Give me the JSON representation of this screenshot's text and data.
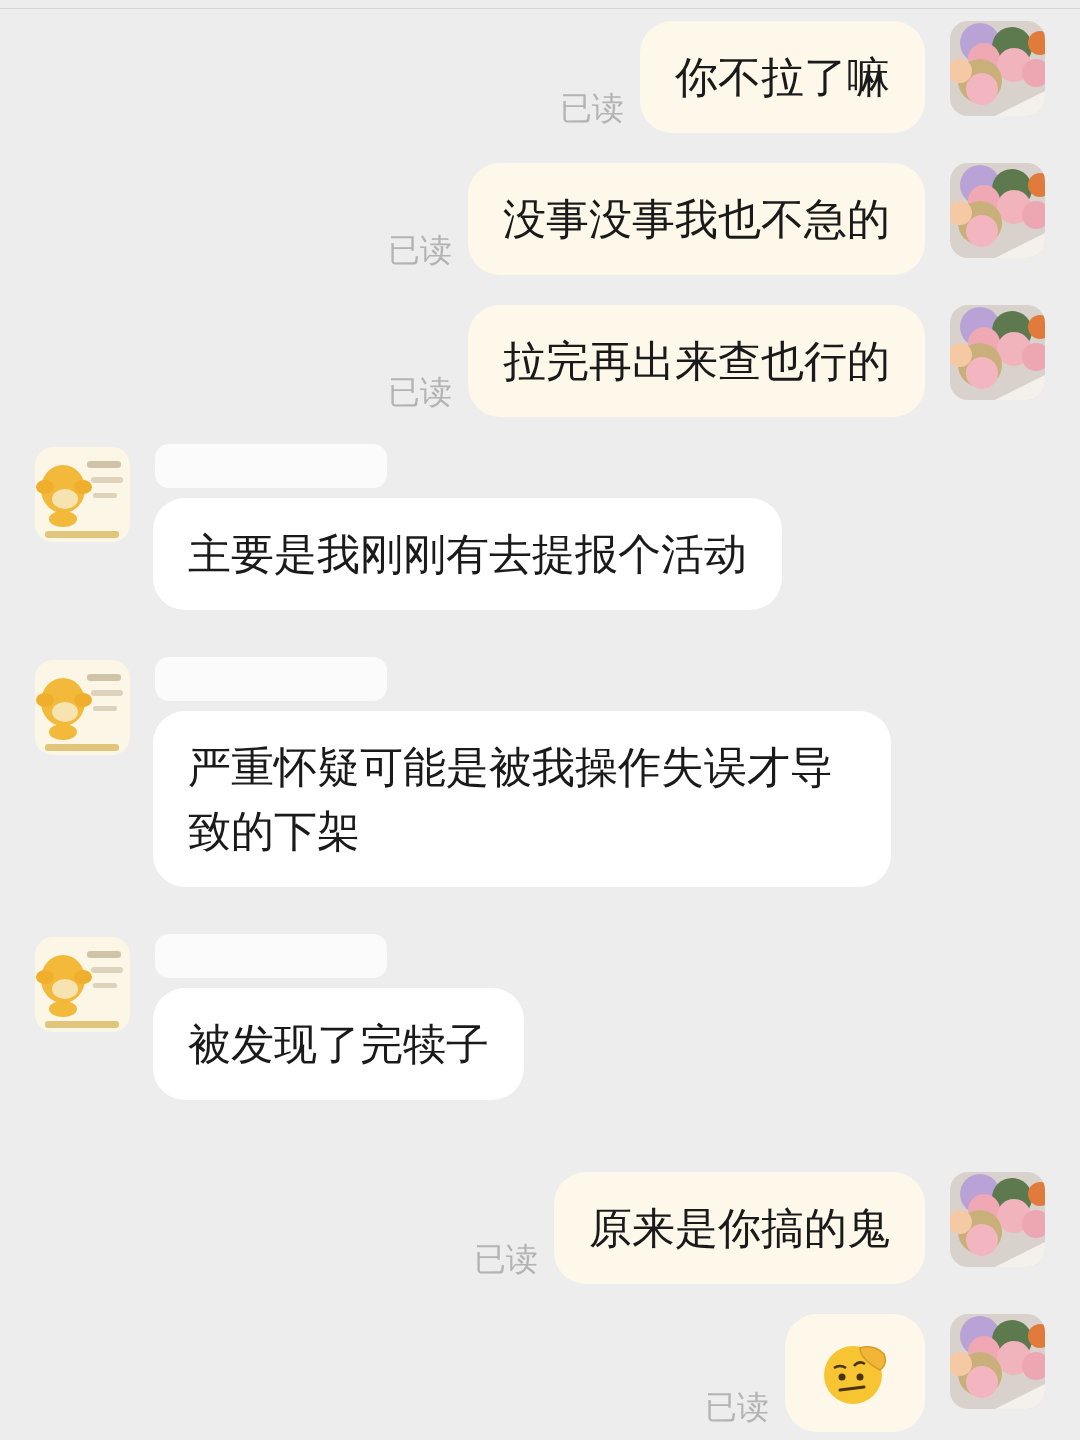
{
  "messages": [
    {
      "kind": "sent_text",
      "text": "你不拉了嘛",
      "read_receipt": "已读"
    },
    {
      "kind": "sent_text",
      "text": "没事没事我也不急的",
      "read_receipt": "已读"
    },
    {
      "kind": "sent_text",
      "text": "拉完再出来查也行的",
      "read_receipt": "已读"
    },
    {
      "kind": "received_text",
      "text": "主要是我刚刚有去提报个活动",
      "name_hidden": true
    },
    {
      "kind": "received_text",
      "text": "严重怀疑可能是被我操作失误才导致的下架",
      "name_hidden": true
    },
    {
      "kind": "received_text",
      "text": "被发现了完犊子",
      "name_hidden": true
    },
    {
      "kind": "sent_text",
      "text": "原来是你搞的鬼",
      "read_receipt": "已读"
    },
    {
      "kind": "sent_emoji",
      "read_receipt": "已读"
    }
  ]
}
